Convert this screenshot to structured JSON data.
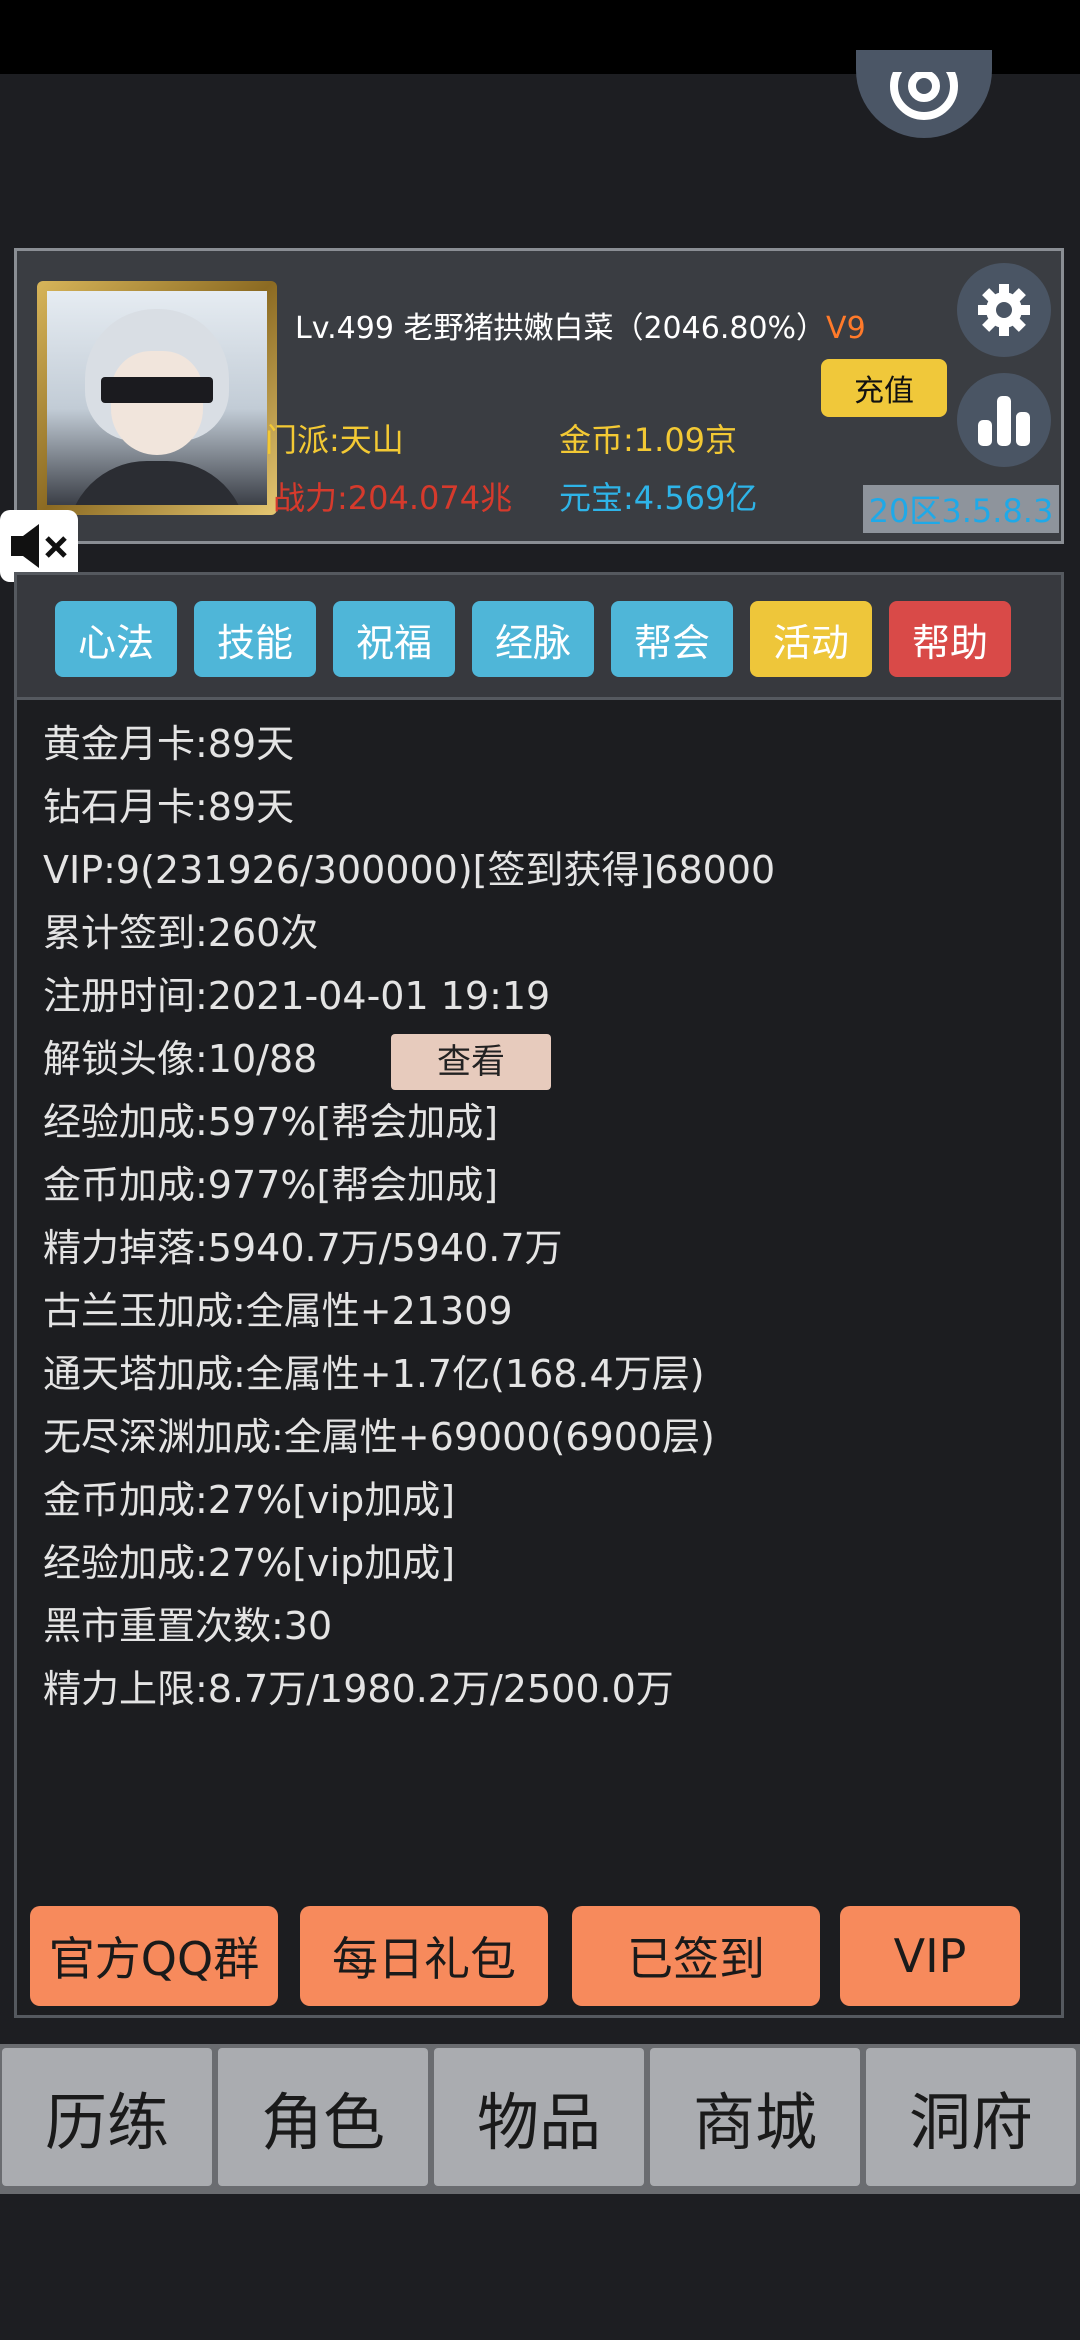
{
  "profile": {
    "name_line": "Lv.499 老野猪拱嫩白菜（2046.80%）",
    "vip_badge": "V9",
    "recharge_label": "充值",
    "sect": "门派:天山",
    "gold": "金币:1.09京",
    "power": "战力:204.074兆",
    "ingot": "元宝:4.569亿",
    "server": "20区3.5.8.3"
  },
  "tabs": [
    {
      "label": "心法",
      "color": "#4fb6d8"
    },
    {
      "label": "技能",
      "color": "#4fb6d8"
    },
    {
      "label": "祝福",
      "color": "#4fb6d8"
    },
    {
      "label": "经脉",
      "color": "#4fb6d8"
    },
    {
      "label": "帮会",
      "color": "#4fb6d8"
    },
    {
      "label": "活动",
      "color": "#eec63a"
    },
    {
      "label": "帮助",
      "color": "#d94a48"
    }
  ],
  "stats": [
    "黄金月卡:89天",
    "钻石月卡:89天",
    "VIP:9(231926/300000)[签到获得]68000",
    "累计签到:260次",
    "注册时间:2021-04-01 19:19",
    "解锁头像:10/88",
    "经验加成:597%[帮会加成]",
    "金币加成:977%[帮会加成]",
    "精力掉落:5940.7万/5940.7万",
    "古兰玉加成:全属性+21309",
    "通天塔加成:全属性+1.7亿(168.4万层)",
    "无尽深渊加成:全属性+69000(6900层)",
    "金币加成:27%[vip加成]",
    "经验加成:27%[vip加成]",
    "黑市重置次数:30",
    "精力上限:8.7万/1980.2万/2500.0万"
  ],
  "view_label": "查看",
  "actions": [
    "官方QQ群",
    "每日礼包",
    "已签到",
    "VIP"
  ],
  "nav": [
    "历练",
    "角色",
    "物品",
    "商城",
    "洞府"
  ],
  "icons": {
    "settings": "gear-icon",
    "ranking": "bar-chart-icon",
    "mute": "speaker-muted-icon",
    "top": "at-sign-icon"
  }
}
